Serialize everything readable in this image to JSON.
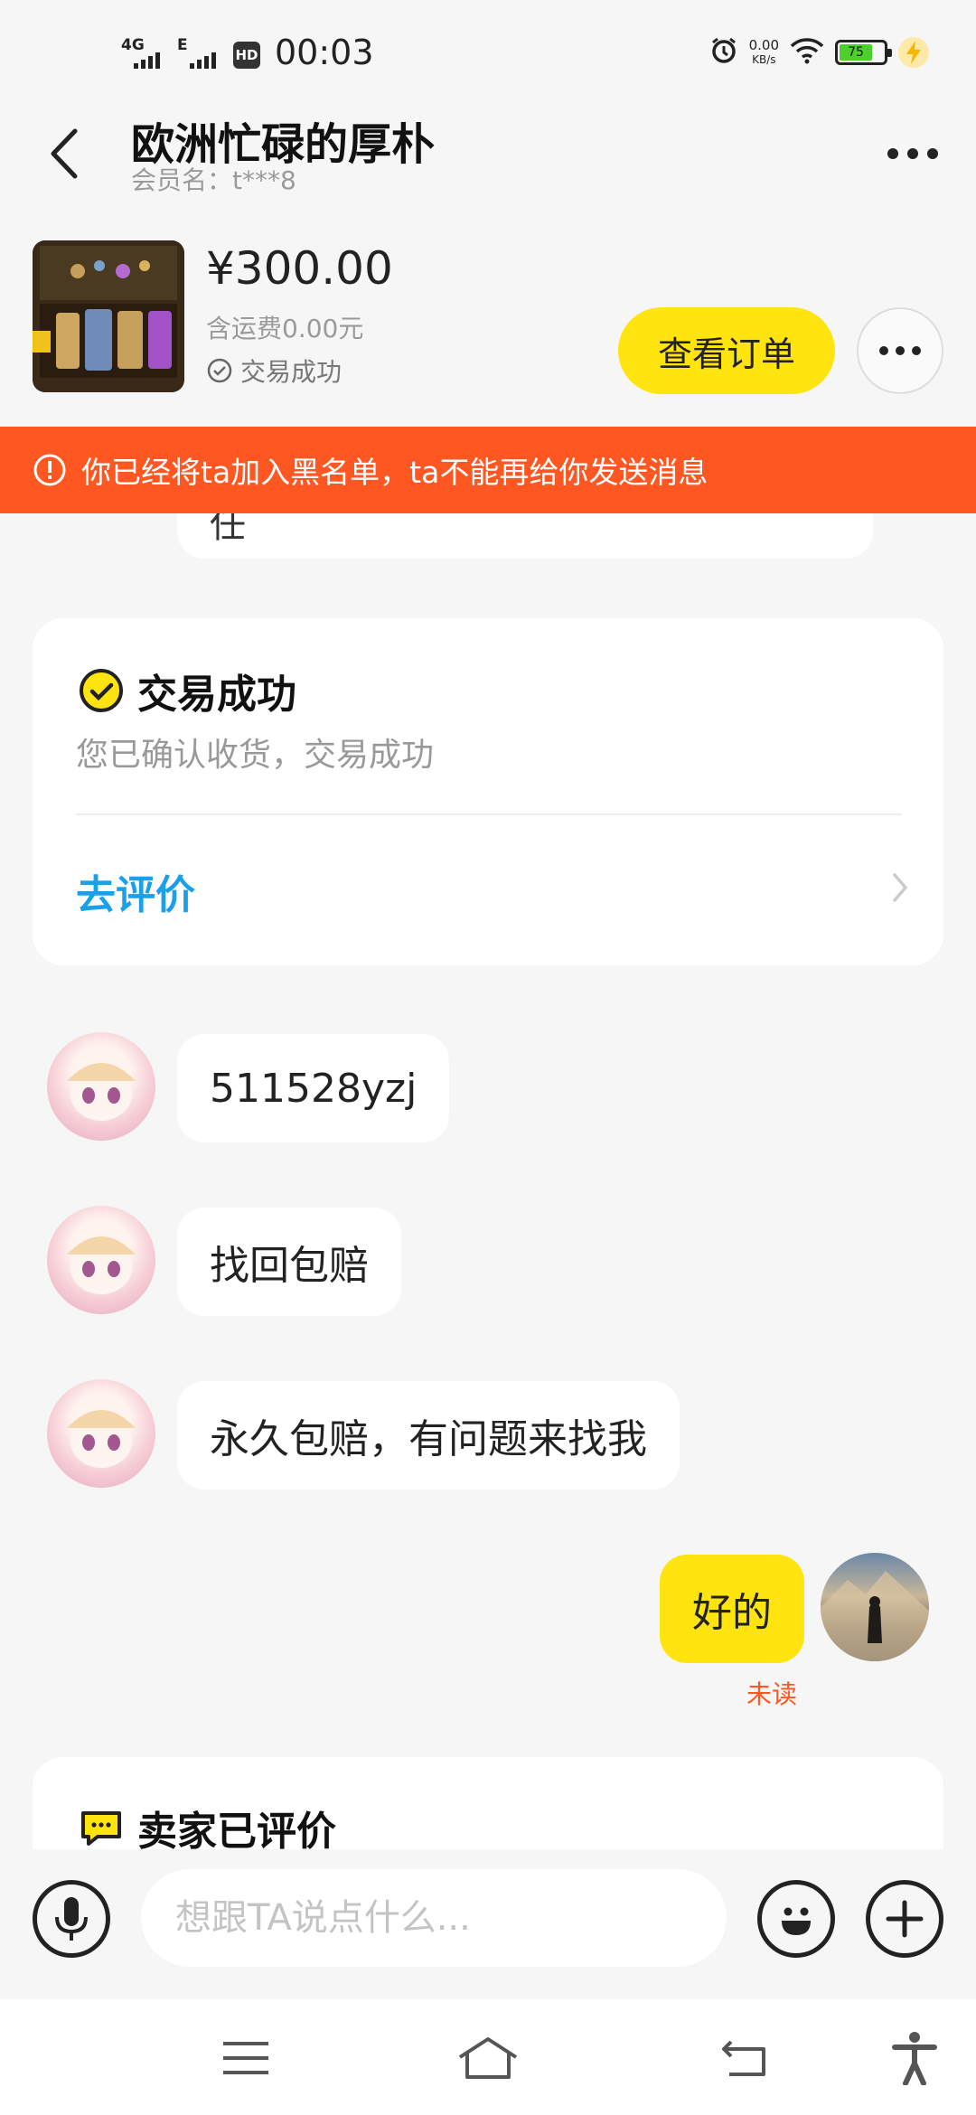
{
  "status_bar": {
    "network_1": "4G",
    "network_2": "E",
    "hd_badge": "HD",
    "time": "00:03",
    "speed_value": "0.00",
    "speed_unit": "KB/s",
    "battery": "75"
  },
  "header": {
    "title": "欧洲忙碌的厚朴",
    "member": "会员名：t***8"
  },
  "order": {
    "price": "¥300.00",
    "shipping": "含运费0.00元",
    "status": "交易成功",
    "view_order_label": "查看订单"
  },
  "banner": {
    "text": "你已经将ta加入黑名单，ta不能再给你发送消息"
  },
  "chat": {
    "cut_text": "任",
    "trade_card": {
      "title": "交易成功",
      "desc": "您已确认收货，交易成功",
      "link": "去评价"
    },
    "messages": [
      {
        "side": "left",
        "text": "511528yzj"
      },
      {
        "side": "left",
        "text": "找回包赔"
      },
      {
        "side": "left",
        "text": "永久包赔，有问题来找我"
      },
      {
        "side": "right",
        "text": "好的",
        "status": "未读"
      }
    ],
    "seller_card": {
      "title": "卖家已评价"
    }
  },
  "input": {
    "placeholder": "想跟TA说点什么..."
  },
  "colors": {
    "accent_yellow": "#ffe40f",
    "banner_orange": "#ff5722",
    "link_blue": "#1aa0e8",
    "background": "#f6f6f6"
  },
  "icons": {
    "back": "chevron-left-icon",
    "more": "ellipsis-icon",
    "voice": "microphone-icon",
    "emoji": "smiley-icon",
    "add": "plus-icon",
    "warning": "alert-circle-icon",
    "check": "check-circle-icon",
    "chat": "chat-bubble-icon",
    "menu": "menu-icon",
    "home": "home-icon",
    "back_nav": "back-arrow-icon",
    "accessibility": "accessibility-icon"
  }
}
